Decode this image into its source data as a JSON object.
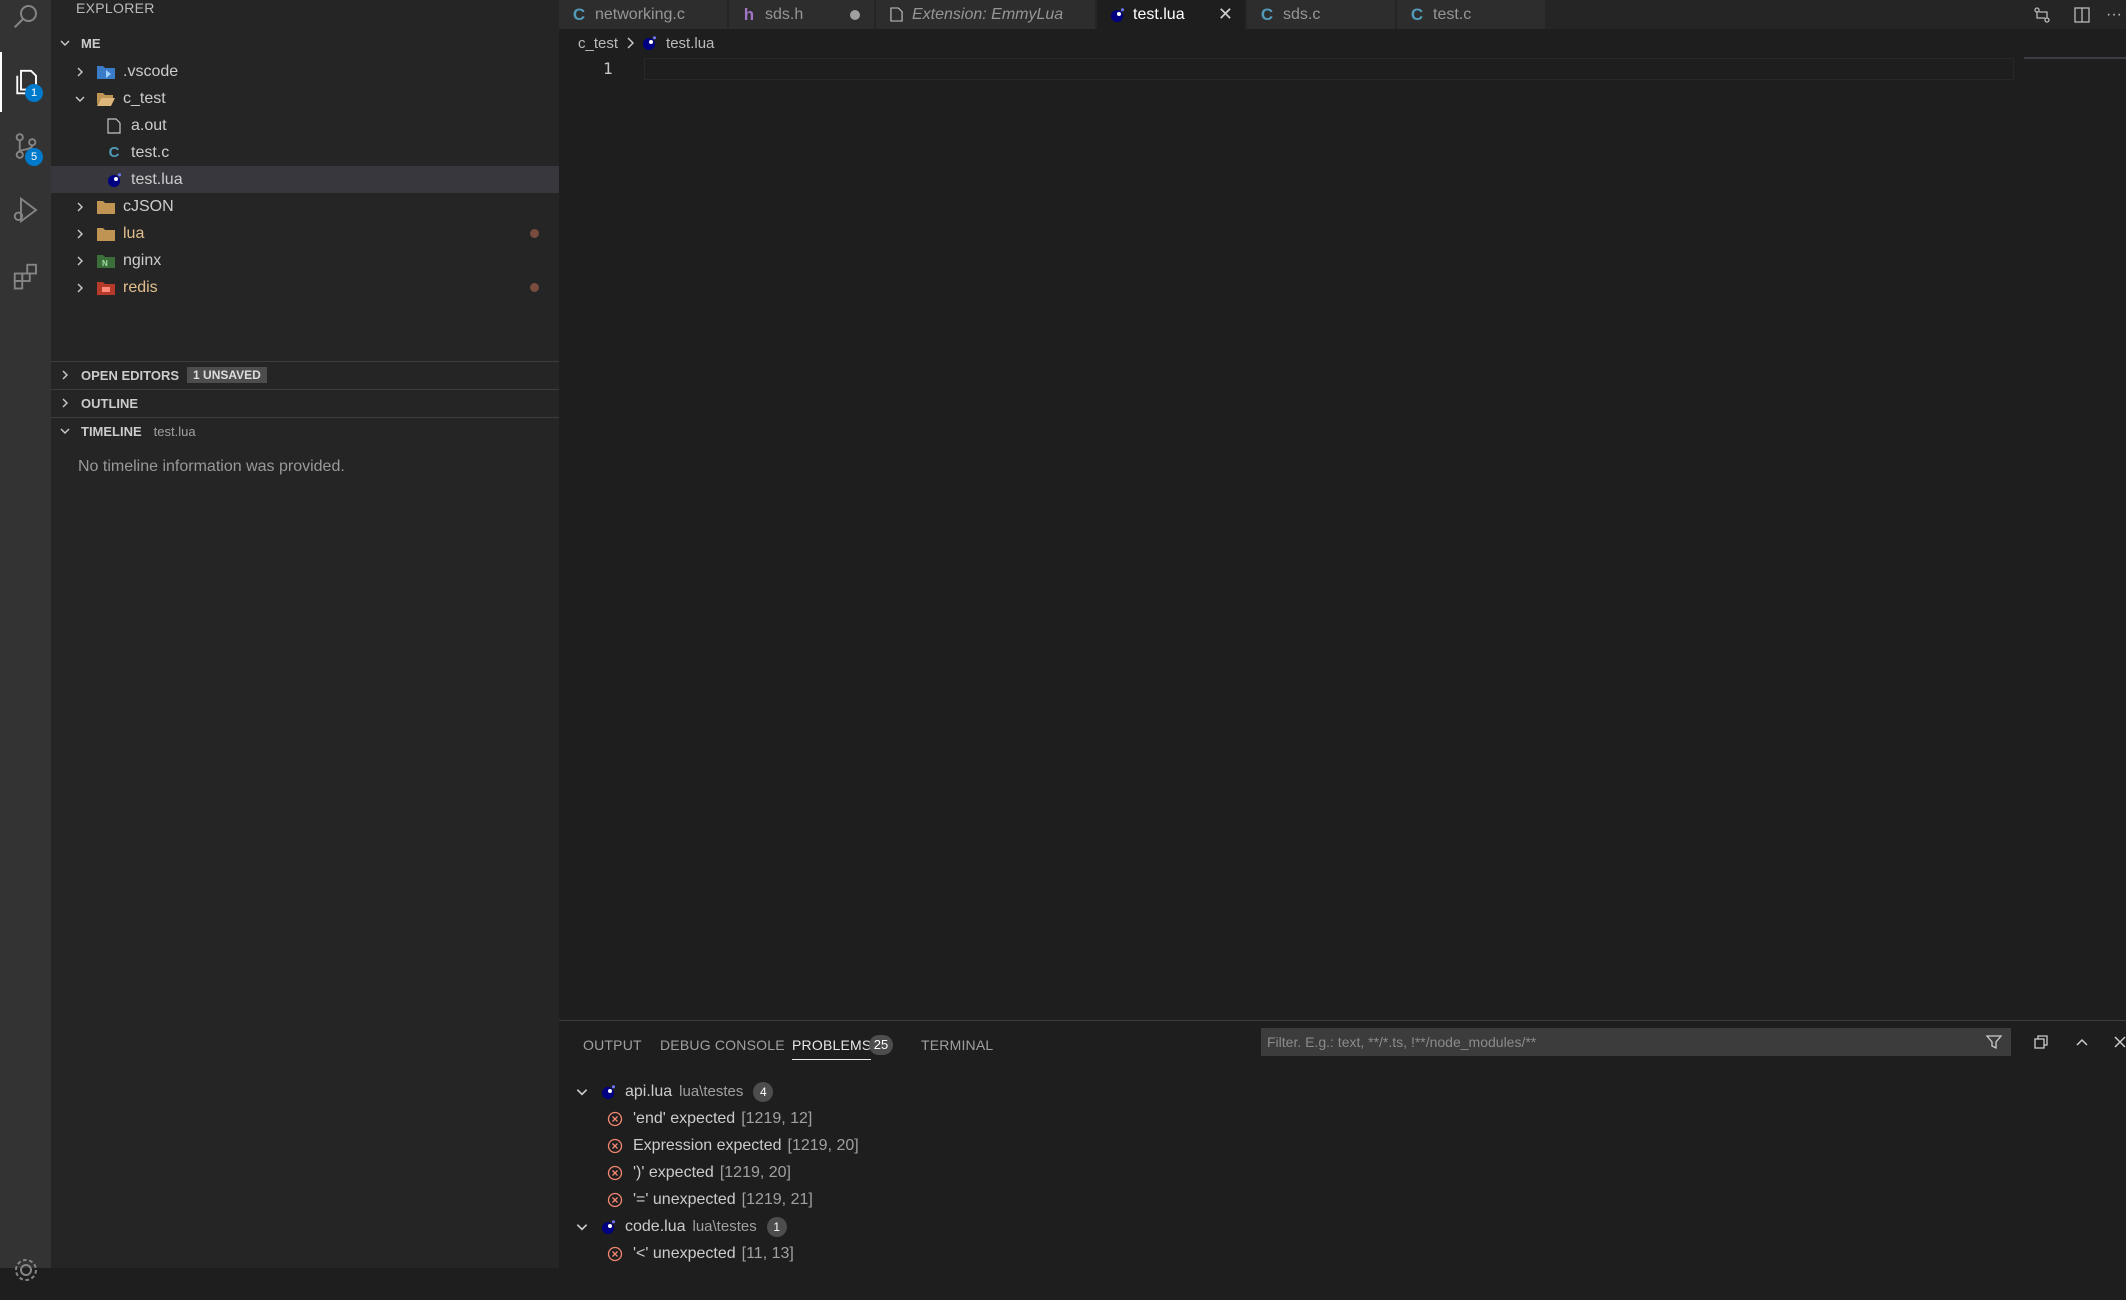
{
  "colors": {
    "accent": "#007acc",
    "error": "#f48771",
    "lua_icon": "#6c73f5",
    "c_icon": "#519aba",
    "h_icon": "#a074c4"
  },
  "sidebar": {
    "title": "EXPLORER",
    "root_label": "ME",
    "tree": [
      {
        "label": ".vscode",
        "icon": "vscode-folder-icon"
      },
      {
        "label": "c_test",
        "icon": "open-folder-icon"
      },
      {
        "label": "a.out",
        "icon": "file-icon"
      },
      {
        "label": "test.c",
        "icon": "c-file-icon",
        "icon_glyph": "C"
      },
      {
        "label": "test.lua",
        "icon": "lua-file-icon"
      },
      {
        "label": "cJSON",
        "icon": "folder-icon"
      },
      {
        "label": "lua",
        "icon": "folder-icon"
      },
      {
        "label": "nginx",
        "icon": "nginx-folder-icon"
      },
      {
        "label": "redis",
        "icon": "redis-folder-icon"
      }
    ],
    "open_editors": {
      "label": "OPEN EDITORS",
      "badge": "1 UNSAVED"
    },
    "outline": {
      "label": "OUTLINE"
    },
    "timeline": {
      "label": "TIMELINE",
      "file": "test.lua",
      "empty_message": "No timeline information was provided."
    }
  },
  "activity": {
    "explorer_badge": "1",
    "scm_badge": "5"
  },
  "tabs": [
    {
      "label": "networking.c",
      "icon_glyph": "C"
    },
    {
      "label": "sds.h",
      "icon_glyph": "h"
    },
    {
      "label": "Extension: EmmyLua"
    },
    {
      "label": "test.lua",
      "close": "✕"
    },
    {
      "label": "sds.c",
      "icon_glyph": "C"
    },
    {
      "label": "test.c",
      "icon_glyph": "C"
    }
  ],
  "breadcrumb": {
    "folder": "c_test",
    "file": "test.lua"
  },
  "editor": {
    "line_number": "1"
  },
  "panel": {
    "tabs": {
      "output": "OUTPUT",
      "debug": "DEBUG CONSOLE",
      "problems": "PROBLEMS",
      "problems_count": "25",
      "terminal": "TERMINAL"
    },
    "filter_placeholder": "Filter. E.g.: text, **/*.ts, !**/node_modules/**",
    "groups": [
      {
        "file": "api.lua",
        "path": "lua\\testes",
        "count": "4",
        "items": [
          {
            "message": "'end' expected",
            "location": "[1219, 12]"
          },
          {
            "message": "Expression expected",
            "location": "[1219, 20]"
          },
          {
            "message": "')' expected",
            "location": "[1219, 20]"
          },
          {
            "message": "'=' unexpected",
            "location": "[1219, 21]"
          }
        ]
      },
      {
        "file": "code.lua",
        "path": "lua\\testes",
        "count": "1",
        "items": [
          {
            "message": "'<' unexpected",
            "location": "[11, 13]"
          }
        ]
      }
    ]
  }
}
